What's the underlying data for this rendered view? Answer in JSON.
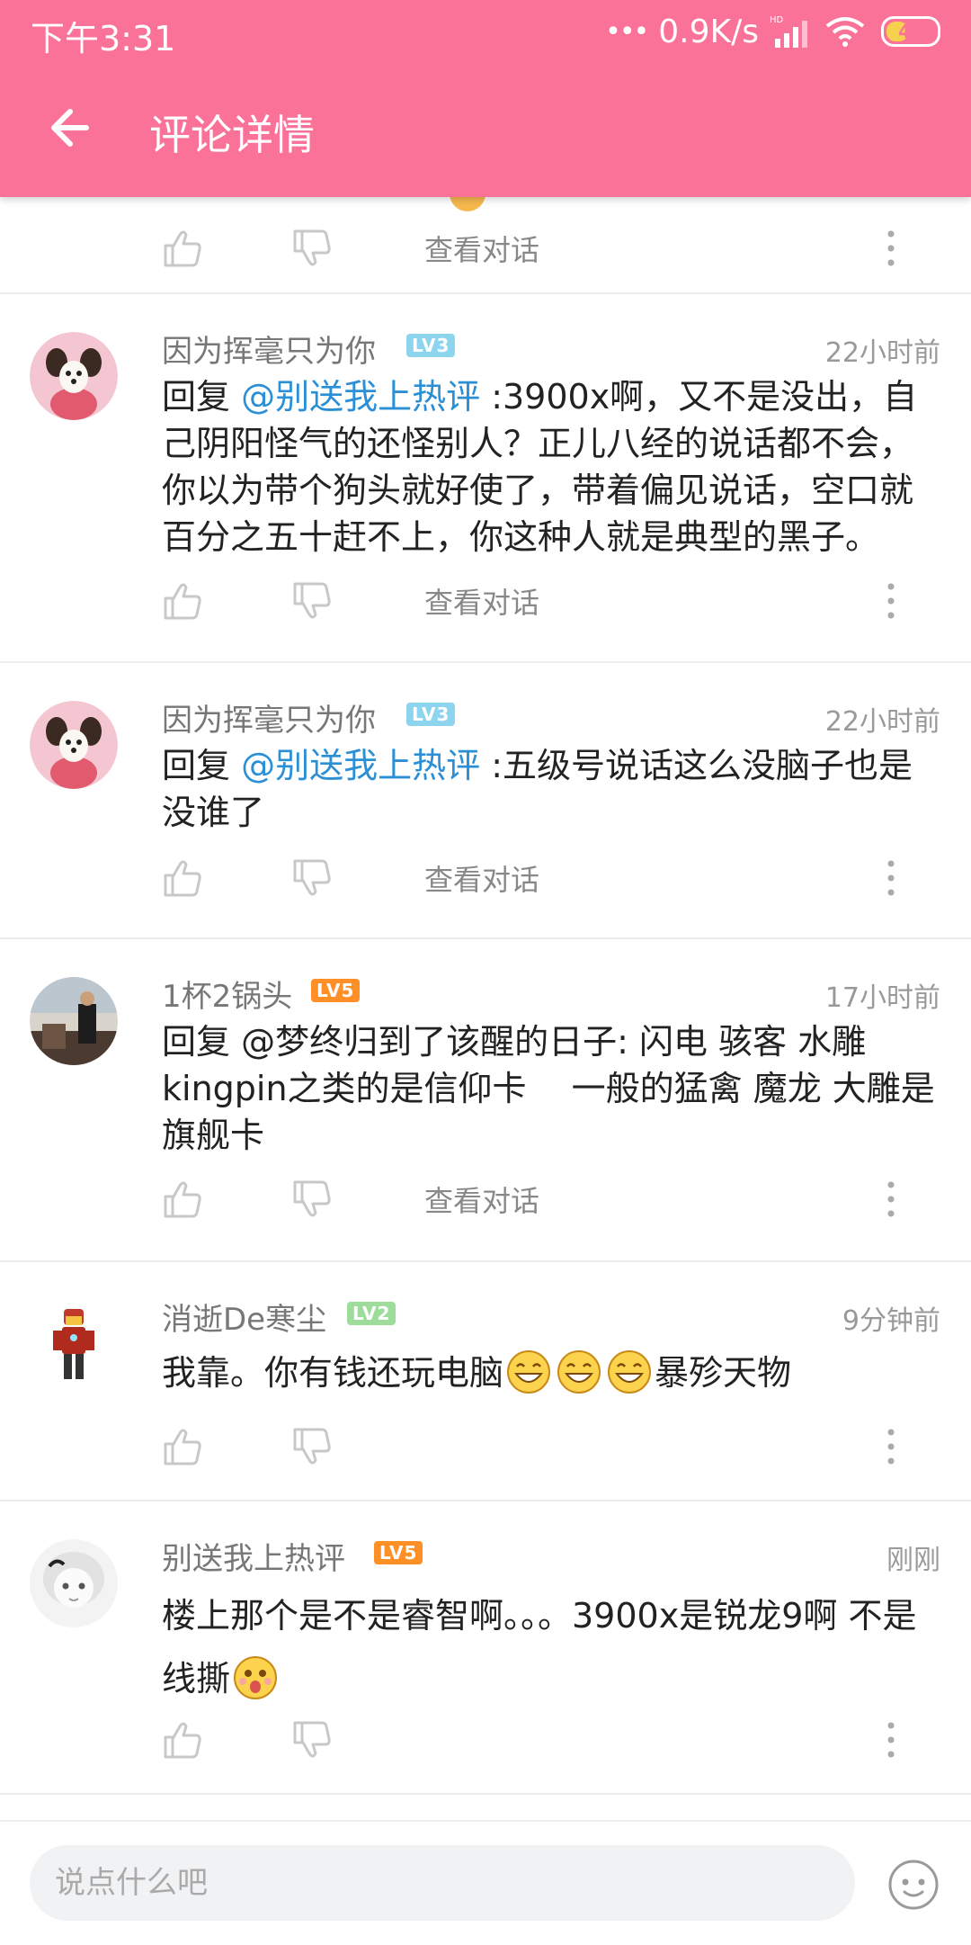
{
  "status_bar": {
    "time": "下午3:31",
    "net_dots": "•••",
    "net_speed": "0.9K/s",
    "battery": "47",
    "battery_level": 0.47
  },
  "header": {
    "title": "评论详情",
    "back_icon": "arrow-left-icon",
    "background": "#fb7299"
  },
  "partial_item": {
    "view_conversation": "查看对话"
  },
  "comments": [
    {
      "username": "因为挥毫只为你",
      "level": "LV3",
      "time": "22小时前",
      "reply_prefix": "回复 ",
      "mention": "@别送我上热评",
      "text": " :3900x啊，又不是没出，自己阴阳怪气的还怪别人？正儿八经的说话都不会，你以为带个狗头就好使了，带着偏见说话，空口就百分之五十赶不上，你这种人就是典型的黑子。",
      "view_conversation": "查看对话"
    },
    {
      "username": "因为挥毫只为你",
      "level": "LV3",
      "time": "22小时前",
      "reply_prefix": "回复 ",
      "mention": "@别送我上热评",
      "text": " :五级号说话这么没脑子也是没谁了",
      "view_conversation": "查看对话"
    },
    {
      "username": "1杯2锅头",
      "level": "LV5",
      "time": "17小时前",
      "text": "回复 @梦终归到了该醒的日子: 闪电 骇客 水雕 kingpin之类的是信仰卡　 一般的猛禽 魔龙 大雕是旗舰卡",
      "view_conversation": "查看对话"
    },
    {
      "username": "消逝De寒尘",
      "level": "LV2",
      "time": "9分钟前",
      "text_before": "我靠。你有钱还玩电脑",
      "text_after": "暴殄天物"
    },
    {
      "username": "别送我上热评",
      "level": "LV5",
      "time": "刚刚",
      "text": "楼上那个是不是睿智啊。。。3900x是锐龙9啊 不是线撕"
    }
  ],
  "bottom_bar": {
    "placeholder": "说点什么吧",
    "emoji_icon": "smiley-face-icon"
  },
  "colors": {
    "accent_pink": "#fb7299",
    "mention_blue": "#2b8fd6",
    "level3": "#8dd4ef",
    "level5": "#ff8f27",
    "level2": "#9edc9b"
  }
}
